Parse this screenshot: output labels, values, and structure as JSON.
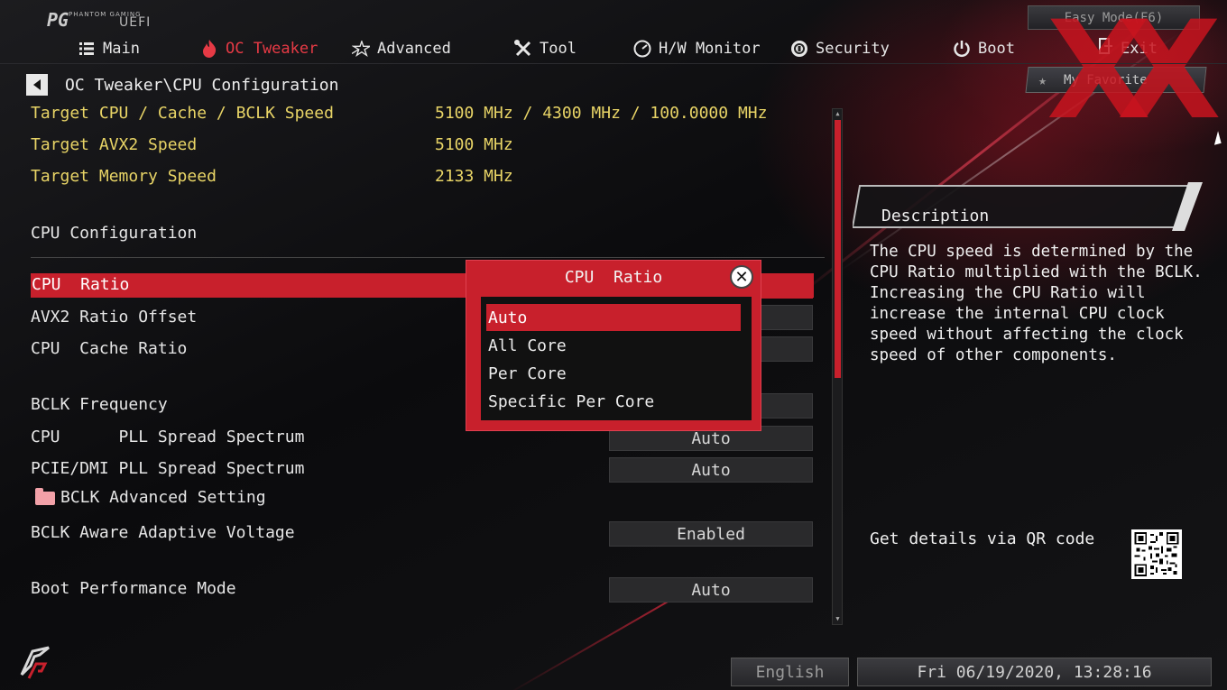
{
  "header": {
    "brand_small": "PHANTOM GAMING",
    "brand_uefi": "UEFI",
    "easy_mode": "Easy Mode(F6)",
    "exit": "Exit",
    "my_favorite": "My Favorite"
  },
  "tabs": [
    {
      "label": "Main",
      "icon": "list-icon"
    },
    {
      "label": "OC Tweaker",
      "icon": "flame-icon",
      "active": true
    },
    {
      "label": "Advanced",
      "icon": "star-icon"
    },
    {
      "label": "Tool",
      "icon": "tools-icon"
    },
    {
      "label": "H/W Monitor",
      "icon": "monitor-icon"
    },
    {
      "label": "Security",
      "icon": "shield-icon"
    },
    {
      "label": "Boot",
      "icon": "power-icon"
    }
  ],
  "breadcrumb": "OC Tweaker\\CPU Configuration",
  "targets": [
    {
      "label": "Target CPU / Cache / BCLK Speed",
      "value": "5100 MHz / 4300 MHz / 100.0000 MHz"
    },
    {
      "label": "Target AVX2 Speed",
      "value": "5100 MHz"
    },
    {
      "label": "Target Memory Speed",
      "value": "2133 MHz"
    }
  ],
  "section_title": "CPU Configuration",
  "settings": [
    {
      "label": "CPU  Ratio",
      "value": "Auto"
    },
    {
      "label": "AVX2 Ratio Offset",
      "value": ""
    },
    {
      "label": "CPU  Cache Ratio",
      "value": ""
    },
    {
      "label": "BCLK Frequency",
      "value": ""
    },
    {
      "label": "CPU      PLL Spread Spectrum",
      "value": "Auto"
    },
    {
      "label": "PCIE/DMI PLL Spread Spectrum",
      "value": "Auto"
    },
    {
      "label": "BCLK Advanced Setting",
      "value": ""
    },
    {
      "label": "BCLK Aware Adaptive Voltage",
      "value": "Enabled"
    },
    {
      "label": "Boot Performance Mode",
      "value": "Auto"
    }
  ],
  "popup": {
    "title": "CPU  Ratio",
    "options": [
      "Auto",
      "All Core",
      "Per Core",
      "Specific Per Core"
    ],
    "selected": "Auto"
  },
  "description": {
    "title": "Description",
    "text": "The CPU speed is determined by the CPU Ratio multiplied with the BCLK. Increasing the CPU Ratio will increase the internal CPU clock speed without affecting the clock speed of other components.",
    "qr_label": "Get details via QR code"
  },
  "footer": {
    "language": "English",
    "datetime": "Fri 06/19/2020, 13:28:16"
  },
  "colors": {
    "accent": "#c8202c",
    "target_text": "#e8d466",
    "active_tab": "#e63a45"
  }
}
